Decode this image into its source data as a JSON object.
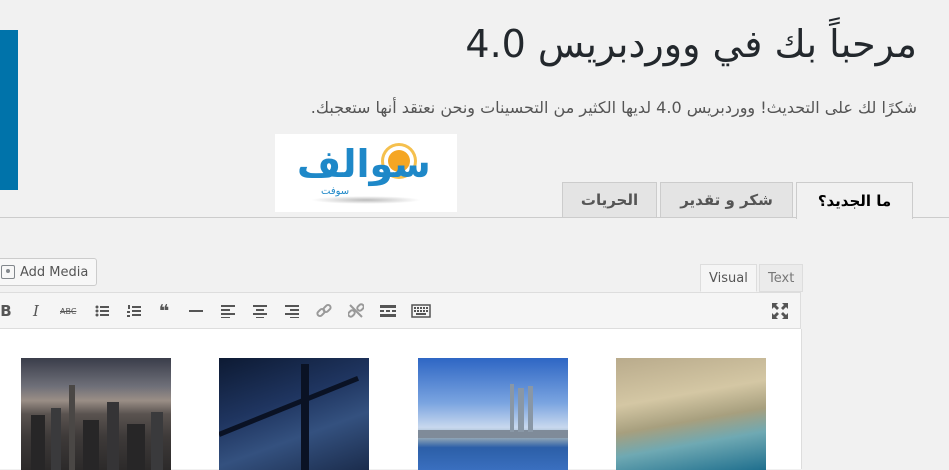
{
  "header": {
    "title": "مرحباً بك في ووردبريس 4.0",
    "subtitle": "شكرًا لك على التحديث! ووردبريس 4.0 لديها الكثير من التحسينات ونحن نعتقد أنها ستعجبك."
  },
  "logo": {
    "text": "سوالف",
    "subtext": "سوفت"
  },
  "tabs": [
    {
      "label": "ما الجديد؟",
      "active": true
    },
    {
      "label": "شكر و تقدير",
      "active": false
    },
    {
      "label": "الحريات",
      "active": false
    }
  ],
  "editor": {
    "add_media_label": "Add Media",
    "mode_visual": "Visual",
    "mode_text": "Text",
    "toolbar": {
      "bold": "B",
      "italic": "I",
      "strike": "ABC",
      "blockquote": "❝"
    },
    "images": [
      {
        "icon": "city-skyline-image"
      },
      {
        "icon": "bridge-night-image"
      },
      {
        "icon": "bay-skyline-image"
      },
      {
        "icon": "coast-aerial-image"
      }
    ]
  },
  "colors": {
    "accent": "#0073aa",
    "background": "#f1f1f1"
  }
}
